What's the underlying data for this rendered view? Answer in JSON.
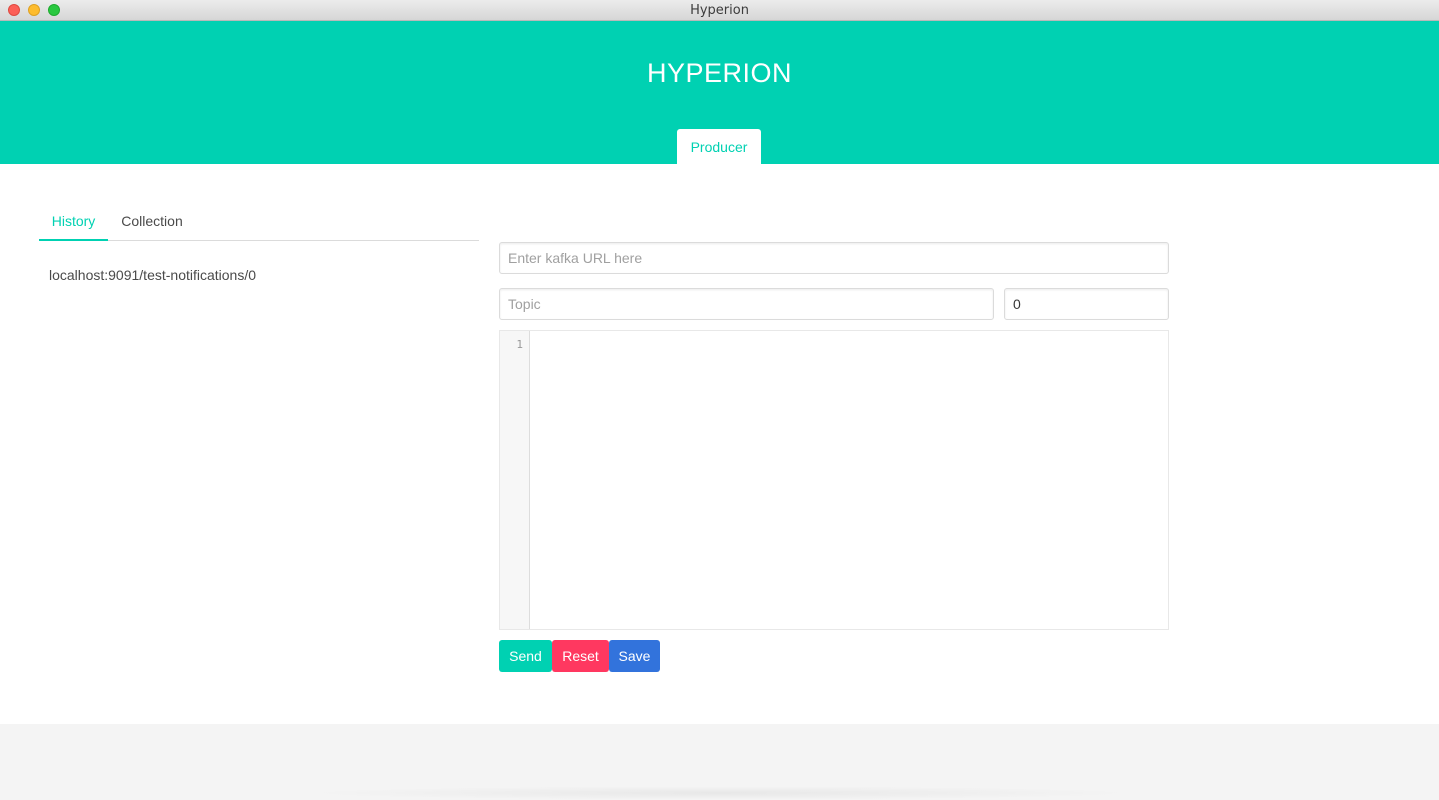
{
  "window": {
    "title": "Hyperion"
  },
  "header": {
    "title": "HYPERION",
    "tabs": [
      {
        "label": "Producer",
        "active": true
      }
    ]
  },
  "sidebar": {
    "tabs": [
      {
        "label": "History",
        "active": true
      },
      {
        "label": "Collection",
        "active": false
      }
    ],
    "history_items": [
      "localhost:9091/test-notifications/0"
    ]
  },
  "form": {
    "url": {
      "value": "",
      "placeholder": "Enter kafka URL here"
    },
    "topic": {
      "value": "",
      "placeholder": "Topic"
    },
    "partition": {
      "value": "0",
      "placeholder": ""
    },
    "editor": {
      "line_numbers": [
        "1"
      ],
      "content": ""
    },
    "buttons": {
      "send": "Send",
      "reset": "Reset",
      "save": "Save"
    }
  },
  "colors": {
    "primary": "#00d1b2",
    "danger": "#ff3860",
    "link": "#3273dc",
    "text": "#4a4a4a"
  },
  "icons": {
    "window_controls": [
      "close-icon",
      "minimize-icon",
      "maximize-icon"
    ]
  }
}
